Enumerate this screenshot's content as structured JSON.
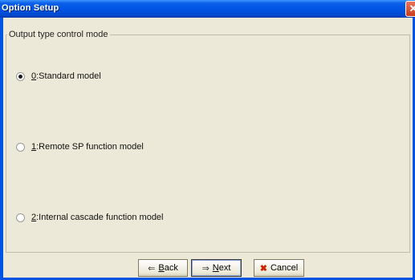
{
  "window": {
    "title": "Option Setup",
    "close_glyph": "✕"
  },
  "group": {
    "label": "Output type control mode"
  },
  "options": [
    {
      "key": "0",
      "label": ":Standard model",
      "checked": true
    },
    {
      "key": "1",
      "label": ":Remote SP function model",
      "checked": false
    },
    {
      "key": "2",
      "label": ":Internal cascade function model",
      "checked": false
    }
  ],
  "buttons": {
    "back": {
      "icon": "back-arrow-icon",
      "glyph": "⇐",
      "mnemonic": "B",
      "rest": "ack"
    },
    "next": {
      "icon": "next-arrow-icon",
      "glyph": "⇒",
      "mnemonic": "N",
      "rest": "ext"
    },
    "cancel": {
      "icon": "cancel-x-icon",
      "glyph": "✖",
      "label": "Cancel"
    }
  },
  "colors": {
    "titlebar": "#0054e3",
    "cancel_icon": "#cc2200",
    "back_icon": "#333333",
    "next_icon": "#333333"
  }
}
